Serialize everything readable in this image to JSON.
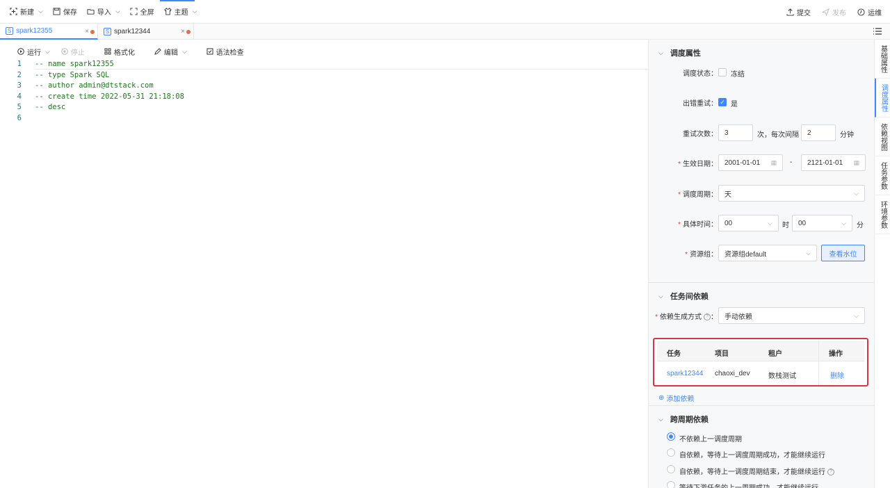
{
  "toolbar": {
    "new": "新建",
    "save": "保存",
    "import": "导入",
    "fullscreen": "全屏",
    "theme": "主题",
    "submit": "提交",
    "publish": "发布",
    "ops": "运维"
  },
  "tabs": [
    {
      "label": "spark12355",
      "badge": "S"
    },
    {
      "label": "spark12344",
      "badge": "S"
    }
  ],
  "editor_toolbar": {
    "run": "运行",
    "stop": "停止",
    "format": "格式化",
    "edit": "编辑",
    "syntax": "语法检查"
  },
  "code": [
    {
      "n": "1",
      "text": "-- name spark12355"
    },
    {
      "n": "2",
      "text": "-- type Spark SQL"
    },
    {
      "n": "3",
      "text": "-- author admin@dtstack.com"
    },
    {
      "n": "4",
      "text": "-- create time 2022-05-31 21:18:08"
    },
    {
      "n": "5",
      "text": "-- desc"
    },
    {
      "n": "6",
      "text": ""
    }
  ],
  "schedule": {
    "title": "调度属性",
    "status_label": "调度状态：",
    "freeze": "冻结",
    "retry_label": "出错重试：",
    "retry_yes": "是",
    "retry_count_label": "重试次数：",
    "retry_count": "3",
    "retry_times_unit": "次，每次间隔",
    "interval": "2",
    "minute_unit": "分钟",
    "date_label": "生效日期：",
    "date_start": "2001-01-01",
    "date_sep": "-",
    "date_end": "2121-01-01",
    "period_label": "调度周期：",
    "period": "天",
    "time_label": "具体时间：",
    "hour": "00",
    "hour_unit": "时",
    "minute": "00",
    "min_unit": "分",
    "resource_label": "资源组：",
    "resource": "资源组default",
    "watermark_btn": "查看水位"
  },
  "dependency": {
    "title": "任务间依赖",
    "mode_label": "依赖生成方式",
    "mode": "手动依赖",
    "columns": [
      "任务",
      "项目",
      "租户",
      "操作"
    ],
    "rows": [
      {
        "task": "spark12344",
        "project": "chaoxi_dev",
        "tenant": "数栈测试",
        "action": "删除"
      }
    ],
    "add": "添加依赖"
  },
  "cross_period": {
    "title": "跨周期依赖",
    "options": [
      "不依赖上一调度周期",
      "自依赖，等待上一调度周期成功，才能继续运行",
      "自依赖，等待上一调度周期结束，才能继续运行",
      "等待下游任务的上一周期成功，才能继续运行"
    ]
  },
  "side_tabs": [
    "基础属性",
    "调度属性",
    "依赖视图",
    "任务参数",
    "环境参数"
  ],
  "colors": {
    "accent": "#3f87ff",
    "highlight": "#d9363e",
    "comment": "#1a7a1a"
  }
}
